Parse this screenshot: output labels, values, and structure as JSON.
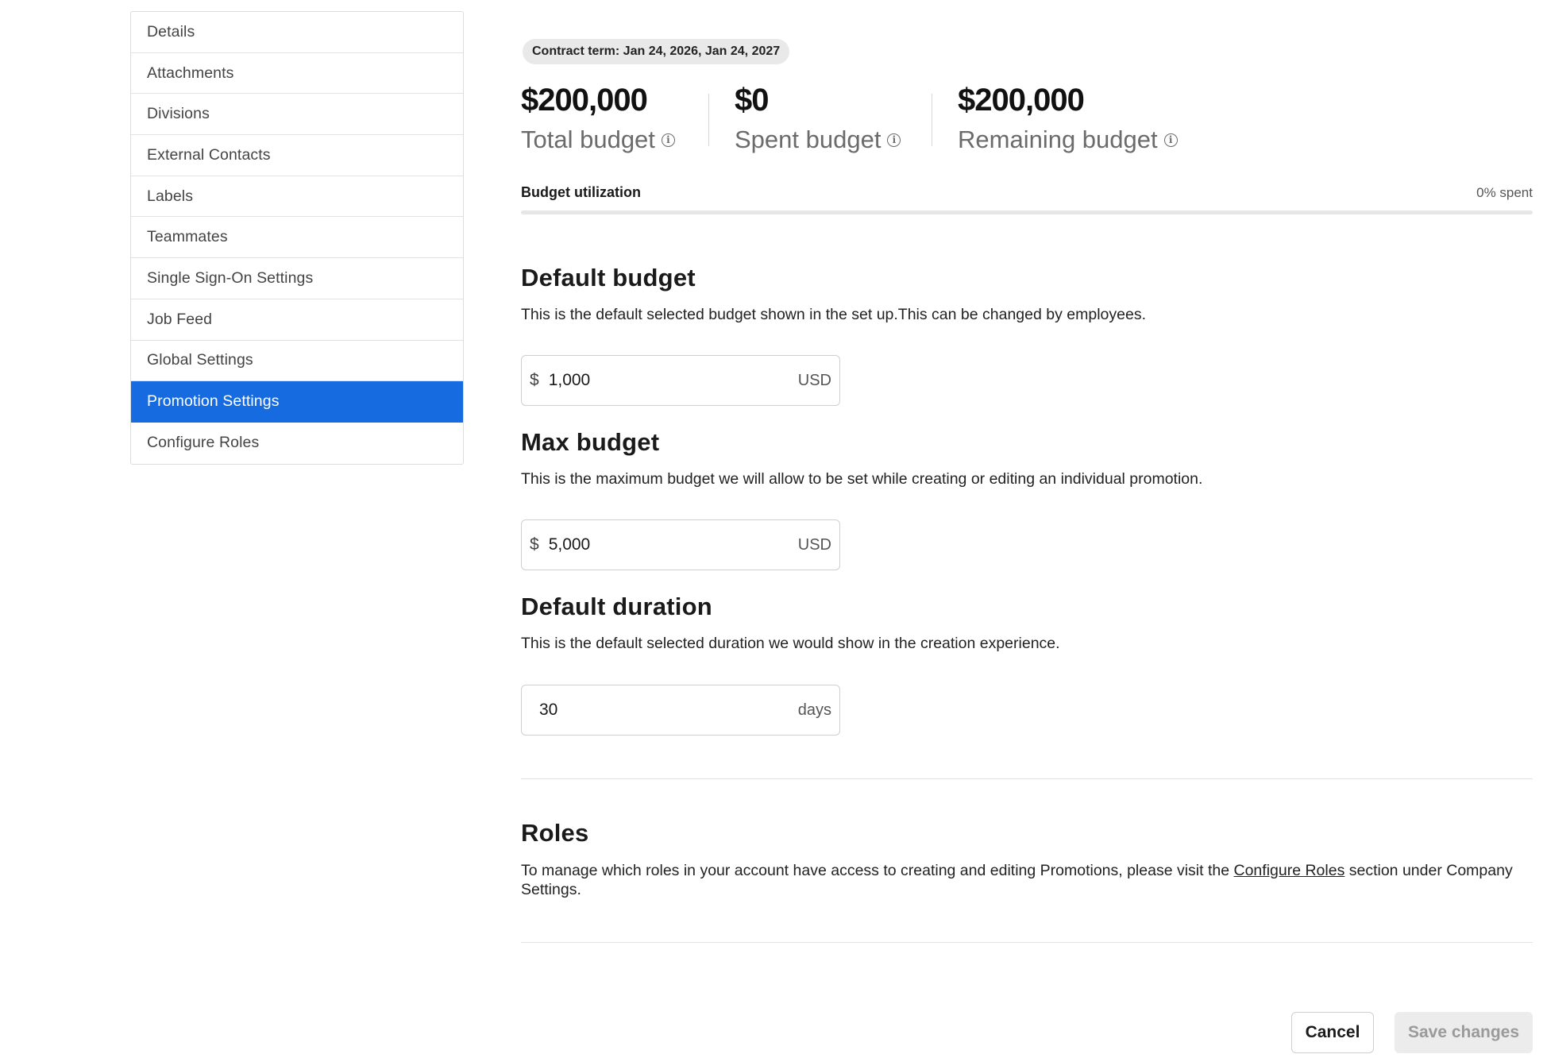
{
  "sidebar": {
    "items": [
      {
        "label": "Details"
      },
      {
        "label": "Attachments"
      },
      {
        "label": "Divisions"
      },
      {
        "label": "External Contacts"
      },
      {
        "label": "Labels"
      },
      {
        "label": "Teammates"
      },
      {
        "label": "Single Sign-On Settings"
      },
      {
        "label": "Job Feed"
      },
      {
        "label": "Global Settings"
      },
      {
        "label": "Promotion Settings",
        "active": true
      },
      {
        "label": "Configure Roles"
      }
    ]
  },
  "contract": {
    "term": "Contract term: Jan 24, 2026, Jan 24, 2027"
  },
  "budget": {
    "total_value": "$200,000",
    "total_label": "Total budget",
    "spent_value": "$0",
    "spent_label": "Spent budget",
    "remaining_value": "$200,000",
    "remaining_label": "Remaining budget",
    "utilization_label": "Budget utilization",
    "utilization_spent": "0% spent",
    "utilization_fraction": 0
  },
  "default_budget": {
    "title": "Default budget",
    "description": "This is the default selected budget shown in the set up.This can be changed by employees.",
    "prefix": "$",
    "value": "1,000",
    "suffix": "USD"
  },
  "max_budget": {
    "title": "Max budget",
    "description": "This is the maximum budget we will allow to be set while creating or editing an individual promotion.",
    "prefix": "$",
    "value": "5,000",
    "suffix": "USD"
  },
  "default_duration": {
    "title": "Default duration",
    "description": "This is the default selected duration we would show in the creation experience.",
    "value": "30",
    "suffix": "days"
  },
  "roles": {
    "title": "Roles",
    "text_before": "To manage which roles in your account have access to creating and editing Promotions, please visit the ",
    "link_text": "Configure Roles",
    "text_after": " section under Company Settings."
  },
  "actions": {
    "cancel_label": "Cancel",
    "save_label": "Save changes"
  },
  "colors": {
    "accent": "#176be0",
    "disabled_bg": "#ececec"
  },
  "icons": {
    "info": "info-icon"
  }
}
